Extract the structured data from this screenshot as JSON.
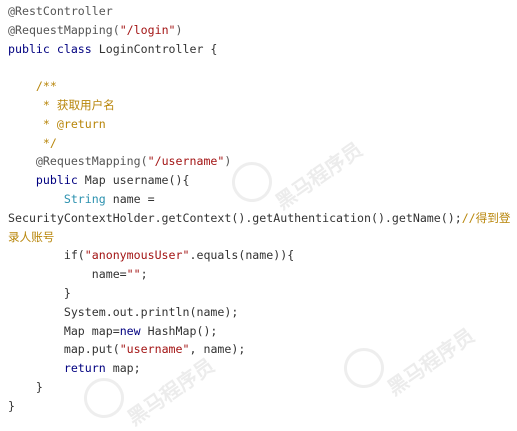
{
  "lines": [
    {
      "segments": [
        {
          "t": "@RestController",
          "c": "ann"
        }
      ]
    },
    {
      "segments": [
        {
          "t": "@RequestMapping(",
          "c": "ann"
        },
        {
          "t": "\"/login\"",
          "c": "str"
        },
        {
          "t": ")",
          "c": "ann"
        }
      ]
    },
    {
      "segments": [
        {
          "t": "public class ",
          "c": "kw"
        },
        {
          "t": "LoginController {",
          "c": ""
        }
      ]
    },
    {
      "segments": [
        {
          "t": "",
          "c": ""
        }
      ]
    },
    {
      "segments": [
        {
          "t": "    /**",
          "c": "cmt"
        }
      ]
    },
    {
      "segments": [
        {
          "t": "     * 获取用户名",
          "c": "cmt"
        }
      ]
    },
    {
      "segments": [
        {
          "t": "     * @return",
          "c": "cmt"
        }
      ]
    },
    {
      "segments": [
        {
          "t": "     */",
          "c": "cmt"
        }
      ]
    },
    {
      "segments": [
        {
          "t": "    @RequestMapping(",
          "c": "ann"
        },
        {
          "t": "\"/username\"",
          "c": "str"
        },
        {
          "t": ")",
          "c": "ann"
        }
      ]
    },
    {
      "segments": [
        {
          "t": "    public ",
          "c": "kw"
        },
        {
          "t": "Map username(){",
          "c": ""
        }
      ]
    },
    {
      "segments": [
        {
          "t": "        ",
          "c": ""
        },
        {
          "t": "String",
          "c": "type"
        },
        {
          "t": " name =",
          "c": ""
        }
      ]
    },
    {
      "segments": [
        {
          "t": "SecurityContextHolder.getContext().getAuthentication().getName();",
          "c": ""
        },
        {
          "t": "//得到登",
          "c": "cmt"
        }
      ]
    },
    {
      "segments": [
        {
          "t": "录人账号",
          "c": "cmt"
        }
      ]
    },
    {
      "segments": [
        {
          "t": "        if(",
          "c": ""
        },
        {
          "t": "\"anonymousUser\"",
          "c": "str"
        },
        {
          "t": ".equals(name)){",
          "c": ""
        }
      ]
    },
    {
      "segments": [
        {
          "t": "            name=",
          "c": ""
        },
        {
          "t": "\"\"",
          "c": "str"
        },
        {
          "t": ";",
          "c": ""
        }
      ]
    },
    {
      "segments": [
        {
          "t": "        }",
          "c": ""
        }
      ]
    },
    {
      "segments": [
        {
          "t": "        System.out.println(name);",
          "c": ""
        }
      ]
    },
    {
      "segments": [
        {
          "t": "        Map map=",
          "c": ""
        },
        {
          "t": "new ",
          "c": "kw"
        },
        {
          "t": "HashMap();",
          "c": ""
        }
      ]
    },
    {
      "segments": [
        {
          "t": "        map.put(",
          "c": ""
        },
        {
          "t": "\"username\"",
          "c": "str"
        },
        {
          "t": ", name);",
          "c": ""
        }
      ]
    },
    {
      "segments": [
        {
          "t": "        ",
          "c": ""
        },
        {
          "t": "return ",
          "c": "kw"
        },
        {
          "t": "map;",
          "c": ""
        }
      ]
    },
    {
      "segments": [
        {
          "t": "    }",
          "c": ""
        }
      ]
    },
    {
      "segments": [
        {
          "t": "}",
          "c": ""
        }
      ]
    }
  ],
  "watermark": {
    "text": "黑马程序员"
  }
}
